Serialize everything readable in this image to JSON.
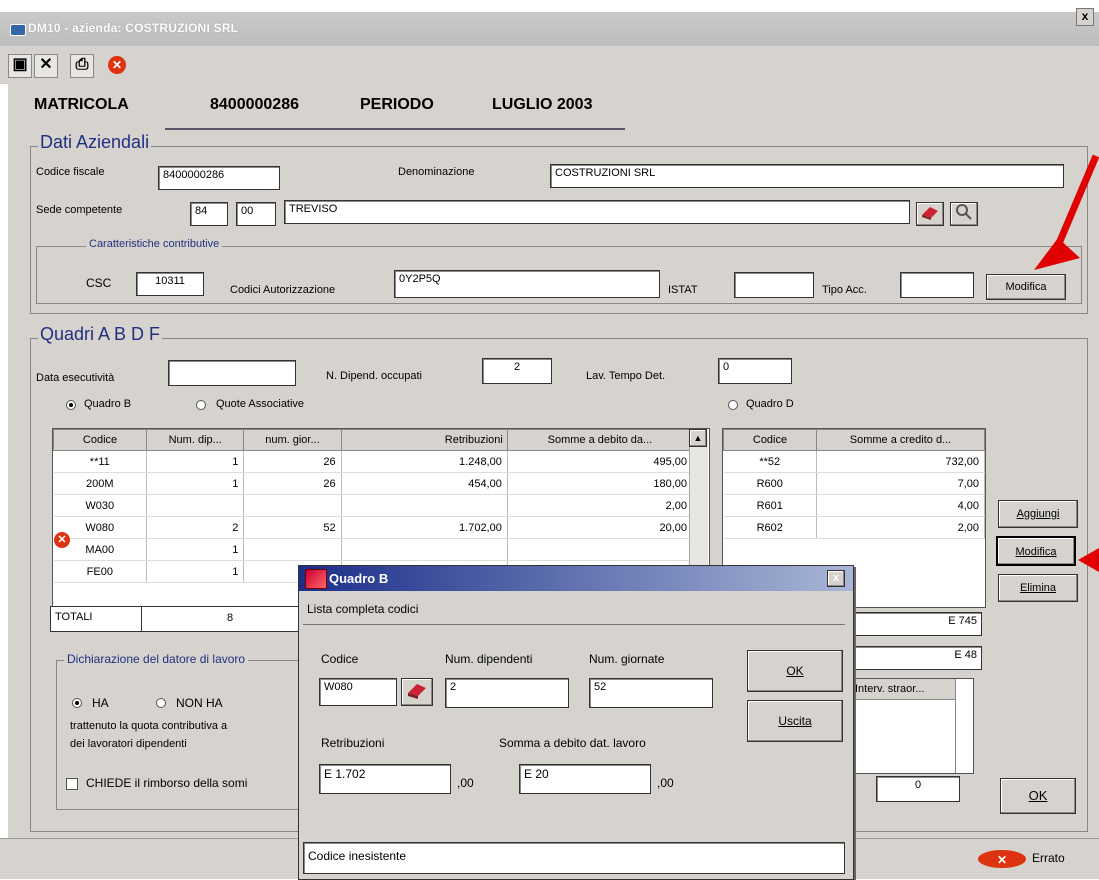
{
  "window": {
    "title": "DM10 - azienda: COSTRUZIONI SRL",
    "close": "x"
  },
  "toolbar": {
    "save": "▣",
    "cancel": "✕",
    "print": "⎙",
    "stop": "✕"
  },
  "header": {
    "matricola_label": "MATRICOLA",
    "matricola_value": "8400000286",
    "periodo_label": "PERIODO",
    "periodo_value": "LUGLIO 2003"
  },
  "dati_aziendali": {
    "legend": "Dati Aziendali",
    "codice_fiscale_label": "Codice fiscale",
    "codice_fiscale_value": "8400000286",
    "denominazione_label": "Denominazione",
    "denominazione_value": "COSTRUZIONI SRL",
    "sede_label": "Sede competente",
    "sede_code1": "84",
    "sede_code2": "00",
    "sede_name": "TREVISO",
    "caratteristiche_legend": "Caratteristiche contributive",
    "csc_label": "CSC",
    "csc_value": "10311",
    "codici_aut_label": "Codici Autorizzazione",
    "codici_aut_value": "0Y2P5Q",
    "istat_label": "ISTAT",
    "istat_value": "",
    "tipo_acc_label": "Tipo Acc.",
    "tipo_acc_value": "",
    "modifica_label": "Modifica"
  },
  "quadri": {
    "legend": "Quadri A B D F",
    "data_esec_label": "Data esecutività",
    "data_esec_value": "",
    "n_dipend_label": "N. Dipend. occupati",
    "n_dipend_value": "2",
    "lav_tempo_label": "Lav. Tempo Det.",
    "lav_tempo_value": "0",
    "radio_quadro_b": "Quadro B",
    "radio_quote": "Quote Associative",
    "radio_quadro_d": "Quadro D",
    "table_b": {
      "columns": [
        "Codice",
        "Num. dip...",
        "num. gior...",
        "Retribuzioni",
        "Somme a debito da..."
      ],
      "rows": [
        [
          "**11",
          "1",
          "26",
          "1.248,00",
          "495,00"
        ],
        [
          "200M",
          "1",
          "26",
          "454,00",
          "180,00"
        ],
        [
          "W030",
          "",
          "",
          "",
          "2,00"
        ],
        [
          "W080",
          "2",
          "52",
          "1.702,00",
          "20,00"
        ],
        [
          "MA00",
          "1",
          "",
          "",
          ""
        ],
        [
          "FE00",
          "1",
          "",
          "",
          ""
        ]
      ],
      "totali_label": "TOTALI",
      "totali_num": "8"
    },
    "table_d": {
      "columns": [
        "Codice",
        "Somme a credito d..."
      ],
      "rows": [
        [
          "**52",
          "732,00"
        ],
        [
          "R600",
          "7,00"
        ],
        [
          "R601",
          "4,00"
        ],
        [
          "R602",
          "2,00"
        ]
      ],
      "total1": "E 745",
      "total2": "E 48"
    },
    "aggiungi": "Aggiungi",
    "modifica": "Modifica",
    "elimina": "Elimina",
    "dichiarazione_legend": "Dichiarazione del datore di lavoro",
    "radio_ha": "HA",
    "radio_nonha": "NON HA",
    "dichiarazione_text1": "trattenuto la quota contributiva a",
    "dichiarazione_text2": "dei lavoratori dipendenti",
    "chiede_label": "CHIEDE il rimborso della somi",
    "small_table_header": "Interv. straor...",
    "bottom_value": "0",
    "ok_label": "OK"
  },
  "dialog": {
    "title": "Quadro B",
    "subtitle": "Lista completa codici",
    "codice_label": "Codice",
    "codice_value": "W080",
    "num_dip_label": "Num. dipendenti",
    "num_dip_value": "2",
    "num_giorn_label": "Num. giornate",
    "num_giorn_value": "52",
    "retribuzioni_label": "Retribuzioni",
    "retribuzioni_value": "E 1.702",
    "retribuzioni_dec": ",00",
    "somma_label": "Somma a debito dat. lavoro",
    "somma_value": "E 20",
    "somma_dec": ",00",
    "ok_label": "OK",
    "uscita_label": "Uscita",
    "status_text": "Codice inesistente",
    "close": "x"
  },
  "statusbar": {
    "error_label": "Errato"
  },
  "colors": {
    "arrow": "#e00000",
    "title_blue": "#1b2f8a",
    "panel": "#d6d3ce"
  }
}
